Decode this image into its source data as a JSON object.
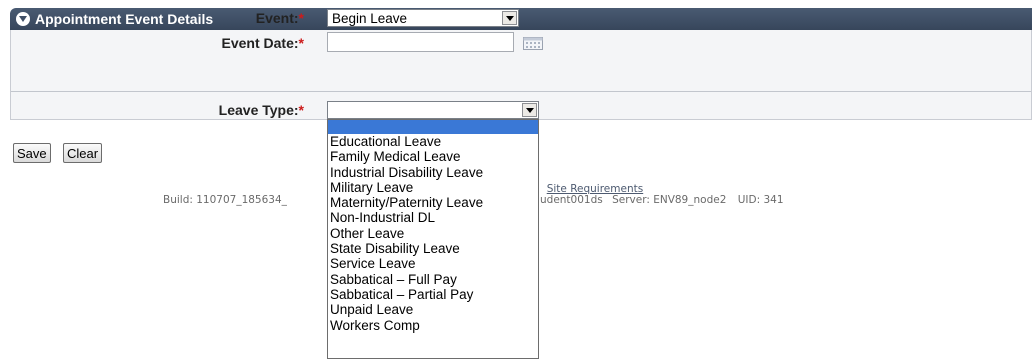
{
  "panel": {
    "title": "Appointment Event Details"
  },
  "form": {
    "event_label": "Event:",
    "event_value": "Begin Leave",
    "event_date_label": "Event Date:",
    "event_date_value": "",
    "leave_type_label": "Leave Type:",
    "leave_type_value": "",
    "required_mark": "*"
  },
  "buttons": {
    "save": "Save",
    "clear": "Clear"
  },
  "footer": {
    "link_partial": "e",
    "separator": "|",
    "site_requirements": "Site Requirements",
    "build_partial": "Build: 110707_185634_",
    "user_partial": "udent001ds",
    "server": "Server: ENV89_node2",
    "uid": "UID: 341"
  },
  "dropdown_options": [
    "",
    "Educational Leave",
    "Family Medical Leave",
    "Industrial Disability Leave",
    "Military Leave",
    "Maternity/Paternity Leave",
    "Non-Industrial DL",
    "Other Leave",
    "State Disability Leave",
    "Service Leave",
    "Sabbatical – Full Pay",
    "Sabbatical – Partial Pay",
    "Unpaid Leave",
    "Workers Comp"
  ],
  "dropdown_selected_index": 0,
  "icons": {
    "collapse": "collapse-toggle-icon",
    "calendar": "calendar-icon",
    "arrow": "chevron-down-icon"
  },
  "colors": {
    "header": "#3f4e65",
    "required": "#cc1b1b",
    "highlight": "#3a78d6"
  }
}
